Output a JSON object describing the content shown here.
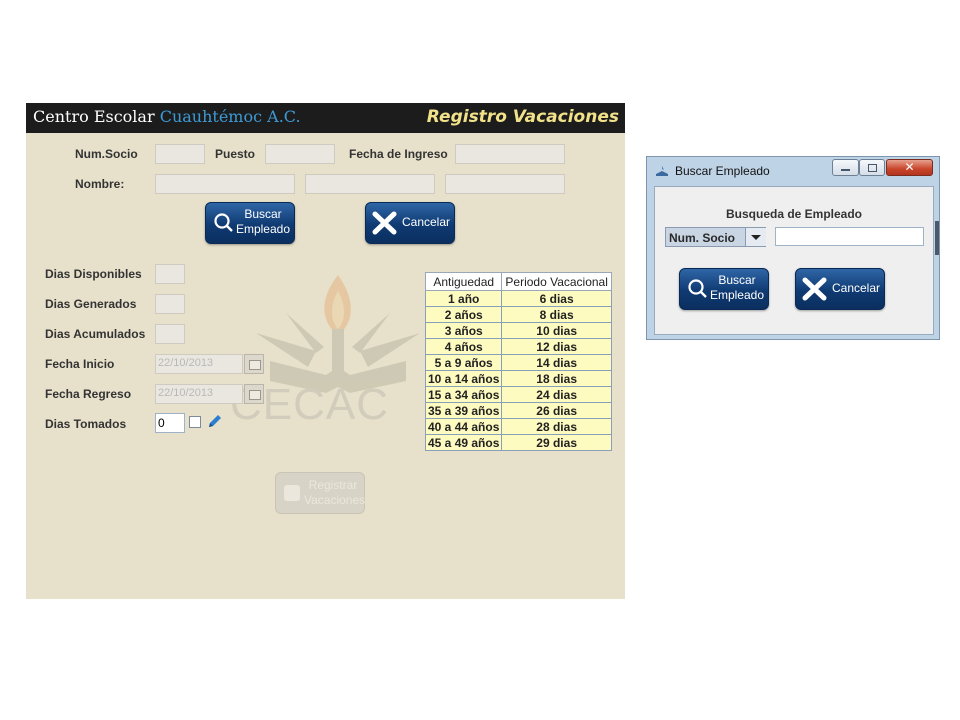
{
  "main": {
    "header": {
      "school_part1": "Centro Escolar",
      "school_part2": "Cuauhtémoc A.C.",
      "form_title": "Registro Vacaciones"
    },
    "labels": {
      "num_socio": "Num.Socio",
      "puesto": "Puesto",
      "fecha_ingreso": "Fecha de Ingreso",
      "nombre": "Nombre:",
      "dias_disponibles": "Dias Disponibles",
      "dias_generados": "Dias Generados",
      "dias_acumulados": "Dias Acumulados",
      "fecha_inicio": "Fecha Inicio",
      "fecha_regreso": "Fecha Regreso",
      "dias_tomados": "Dias Tomados"
    },
    "fields": {
      "fecha_inicio": "22/10/2013",
      "fecha_regreso": "22/10/2013",
      "dias_tomados": "0"
    },
    "buttons": {
      "buscar_line1": "Buscar",
      "buscar_line2": "Empleado",
      "cancelar": "Cancelar",
      "registrar_line1": "Registrar",
      "registrar_line2": "Vacaciones"
    },
    "watermark_text": "CECAC",
    "table": {
      "headers": [
        "Antiguedad",
        "Periodo Vacacional"
      ],
      "rows": [
        [
          "1 año",
          "6 dias"
        ],
        [
          "2 años",
          "8 dias"
        ],
        [
          "3 años",
          "10 dias"
        ],
        [
          "4 años",
          "12 dias"
        ],
        [
          "5 a 9 años",
          "14 dias"
        ],
        [
          "10 a 14 años",
          "18 dias"
        ],
        [
          "15 a 34 años",
          "24 dias"
        ],
        [
          "35 a 39 años",
          "26 dias"
        ],
        [
          "40 a 44 años",
          "28 dias"
        ],
        [
          "45 a 49 años",
          "29 dias"
        ]
      ]
    }
  },
  "dialog": {
    "title": "Buscar Empleado",
    "heading": "Busqueda de Empleado",
    "combo_selected": "Num. Socio",
    "search_value": "",
    "buttons": {
      "buscar_line1": "Buscar",
      "buscar_line2": "Empleado",
      "cancelar": "Cancelar"
    }
  },
  "colors": {
    "form_bg": "#e7e1cb",
    "header_bg": "#1c1c1c",
    "accent_blue": "#3d9ad6",
    "title_yellow": "#f1e28a",
    "button_blue": "#0f3a72",
    "table_cell": "#fefbc0"
  },
  "icons": [
    "search-icon",
    "cancel-x-icon",
    "calendar-icon",
    "edit-pencil-icon",
    "app-icon",
    "minimize-icon",
    "maximize-icon",
    "close-icon",
    "dropdown-arrow-icon"
  ]
}
